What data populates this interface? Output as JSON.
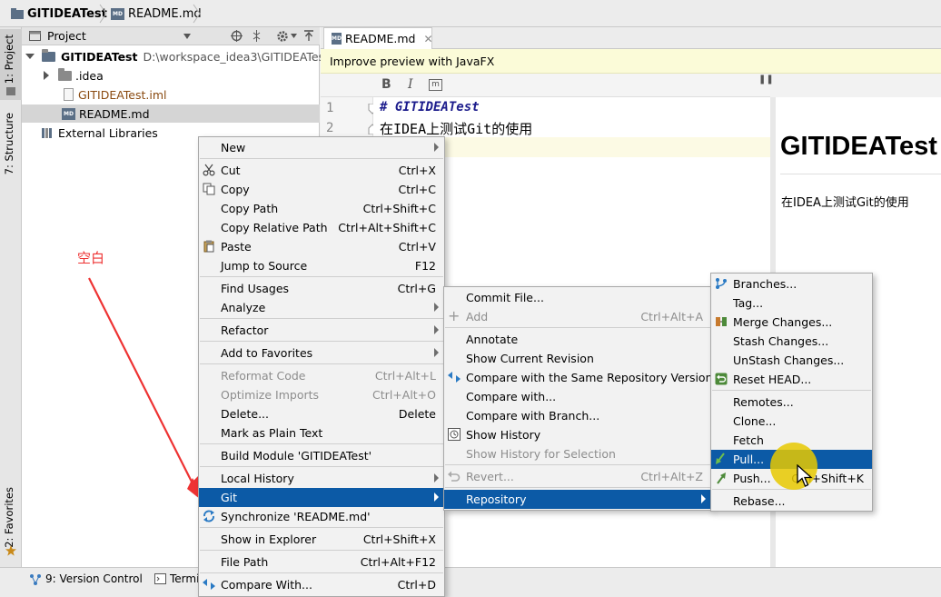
{
  "navbar": {
    "project": "GITIDEATest",
    "file": "README.md"
  },
  "left_strip": {
    "project_tab": "1: Project",
    "structure_tab": "7: Structure",
    "favorites_tab": "2: Favorites"
  },
  "project_panel": {
    "title": "Project",
    "root_name": "GITIDEATest",
    "root_path": "D:\\workspace_idea3\\GITIDEATest",
    "items": [
      ".idea",
      "GITIDEATest.iml",
      "README.md"
    ],
    "external": "External Libraries"
  },
  "editor": {
    "tab_label": "README.md",
    "banner": "Improve preview with JavaFX",
    "toolbar": {
      "bold": "B",
      "italic": "I",
      "code": "m"
    },
    "line_numbers": [
      "1",
      "2"
    ],
    "lines": [
      "# GITIDEATest",
      "在IDEA上测试Git的使用"
    ],
    "preview_heading": "GITIDEATest",
    "preview_text": "在IDEA上测试Git的使用"
  },
  "annotation": {
    "label": "空白",
    "color": "#ee3333"
  },
  "context_menu": {
    "items": [
      {
        "label": "New",
        "shortcut": ""
      },
      {
        "label": "Cut",
        "shortcut": "Ctrl+X"
      },
      {
        "label": "Copy",
        "shortcut": "Ctrl+C"
      },
      {
        "label": "Copy Path",
        "shortcut": "Ctrl+Shift+C"
      },
      {
        "label": "Copy Relative Path",
        "shortcut": "Ctrl+Alt+Shift+C"
      },
      {
        "label": "Paste",
        "shortcut": "Ctrl+V"
      },
      {
        "label": "Jump to Source",
        "shortcut": "F12"
      },
      {
        "label": "Find Usages",
        "shortcut": "Ctrl+G"
      },
      {
        "label": "Analyze",
        "shortcut": ""
      },
      {
        "label": "Refactor",
        "shortcut": ""
      },
      {
        "label": "Add to Favorites",
        "shortcut": ""
      },
      {
        "label": "Reformat Code",
        "shortcut": "Ctrl+Alt+L"
      },
      {
        "label": "Optimize Imports",
        "shortcut": "Ctrl+Alt+O"
      },
      {
        "label": "Delete...",
        "shortcut": "Delete"
      },
      {
        "label": "Mark as Plain Text",
        "shortcut": ""
      },
      {
        "label": "Build Module 'GITIDEATest'",
        "shortcut": ""
      },
      {
        "label": "Local History",
        "shortcut": ""
      },
      {
        "label": "Git",
        "shortcut": ""
      },
      {
        "label": "Synchronize 'README.md'",
        "shortcut": ""
      },
      {
        "label": "Show in Explorer",
        "shortcut": "Ctrl+Shift+X"
      },
      {
        "label": "File Path",
        "shortcut": "Ctrl+Alt+F12"
      },
      {
        "label": "Compare With...",
        "shortcut": "Ctrl+D"
      }
    ]
  },
  "git_menu": {
    "items": [
      {
        "label": "Commit File...",
        "shortcut": ""
      },
      {
        "label": "Add",
        "shortcut": "Ctrl+Alt+A"
      },
      {
        "label": "Annotate",
        "shortcut": ""
      },
      {
        "label": "Show Current Revision",
        "shortcut": ""
      },
      {
        "label": "Compare with the Same Repository Version",
        "shortcut": ""
      },
      {
        "label": "Compare with...",
        "shortcut": ""
      },
      {
        "label": "Compare with Branch...",
        "shortcut": ""
      },
      {
        "label": "Show History",
        "shortcut": ""
      },
      {
        "label": "Show History for Selection",
        "shortcut": ""
      },
      {
        "label": "Revert...",
        "shortcut": "Ctrl+Alt+Z"
      },
      {
        "label": "Repository",
        "shortcut": ""
      }
    ]
  },
  "repo_menu": {
    "items": [
      {
        "label": "Branches...",
        "shortcut": ""
      },
      {
        "label": "Tag...",
        "shortcut": ""
      },
      {
        "label": "Merge Changes...",
        "shortcut": ""
      },
      {
        "label": "Stash Changes...",
        "shortcut": ""
      },
      {
        "label": "UnStash Changes...",
        "shortcut": ""
      },
      {
        "label": "Reset HEAD...",
        "shortcut": ""
      },
      {
        "label": "Remotes...",
        "shortcut": ""
      },
      {
        "label": "Clone...",
        "shortcut": ""
      },
      {
        "label": "Fetch",
        "shortcut": ""
      },
      {
        "label": "Pull...",
        "shortcut": ""
      },
      {
        "label": "Push...",
        "shortcut": "Ctrl+Shift+K"
      },
      {
        "label": "Rebase...",
        "shortcut": ""
      }
    ]
  },
  "bottom_bar": {
    "version_control": "9: Version Control",
    "terminal": "Terminal"
  },
  "colors": {
    "selection": "#0c5aa6",
    "banner": "#fbfbd8",
    "highlight": "#e8c900"
  }
}
